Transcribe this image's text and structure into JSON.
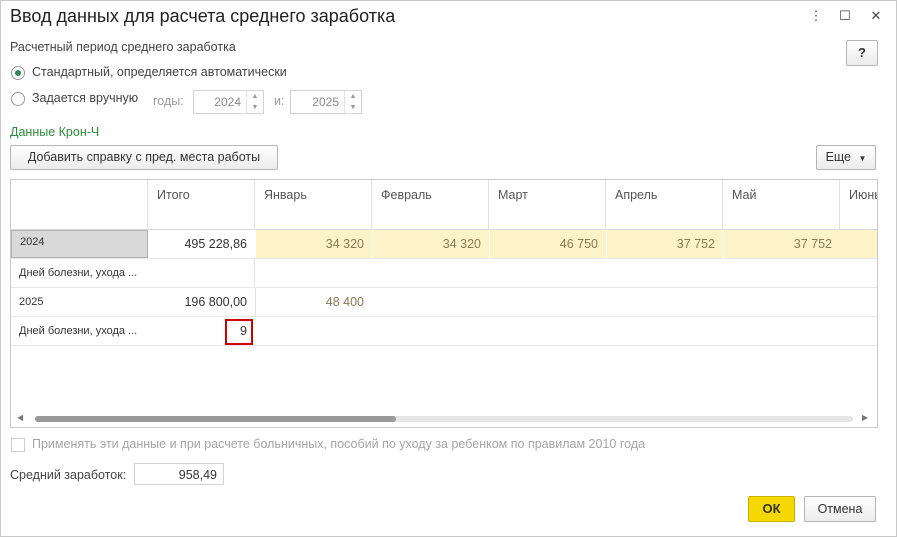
{
  "window": {
    "title": "Ввод данных для расчета среднего заработка",
    "more_icon": "⋮",
    "maximize_icon": "☐",
    "close_icon": "✕",
    "help_label": "?"
  },
  "period": {
    "heading": "Расчетный период среднего заработка",
    "option_auto": "Стандартный, определяется автоматически",
    "option_manual": "Задается вручную",
    "selected": "auto",
    "years_label": "годы:",
    "year_from": "2024",
    "and_label": "и:",
    "year_to": "2025"
  },
  "source_label": "Данные Крон-Ч",
  "add_button": "Добавить справку с пред. места работы",
  "more_button": "Еще",
  "table": {
    "columns": [
      "",
      "Итого",
      "Январь",
      "Февраль",
      "Март",
      "Апрель",
      "Май",
      "Июнь"
    ],
    "rows": [
      {
        "label": "2024",
        "total": "495 228,86",
        "months": [
          "34 320",
          "34 320",
          "46 750",
          "37 752",
          "37 752",
          ""
        ]
      },
      {
        "label": "Дней болезни, ухода ...",
        "total": "",
        "months": [
          "",
          "",
          "",
          "",
          "",
          ""
        ]
      },
      {
        "label": "2025",
        "total": "196 800,00",
        "months": [
          "48 400",
          "",
          "",
          "",
          "",
          ""
        ]
      },
      {
        "label": "Дней болезни, ухода ...",
        "total": "9",
        "months": [
          "",
          "",
          "",
          "",
          "",
          ""
        ]
      }
    ],
    "scroll_position": 0.45
  },
  "apply_checkbox_label": "Применять эти данные и при расчете больничных, пособий по уходу за ребенком по правилам 2010 года",
  "average_label": "Средний заработок:",
  "average_value": "958,49",
  "ok_button": "ОК",
  "cancel_button": "Отмена",
  "colors": {
    "accent": "#f5d800",
    "highlight_row": "#fdf3c8",
    "source_green": "#2e8b3c",
    "error_outline": "#d00000"
  }
}
